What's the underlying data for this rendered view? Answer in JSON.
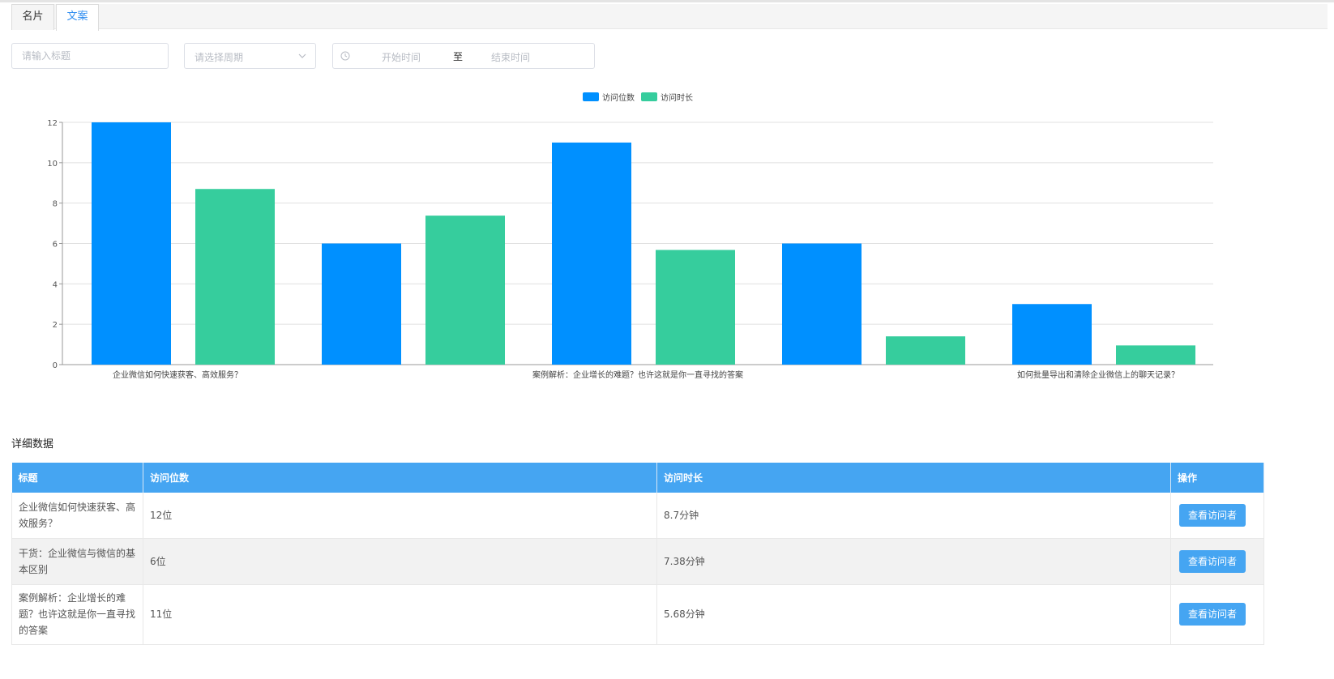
{
  "tabs": [
    {
      "label": "名片",
      "active": false
    },
    {
      "label": "文案",
      "active": true
    }
  ],
  "filters": {
    "title_placeholder": "请输入标题",
    "period_placeholder": "请选择周期",
    "start_placeholder": "开始时间",
    "range_separator": "至",
    "end_placeholder": "结束时间"
  },
  "colors": {
    "accent": "#2d8cf0",
    "series_visits": "#0090ff",
    "series_duration": "#36cd9d",
    "table_header": "#45a5f2"
  },
  "chart_data": {
    "type": "bar",
    "categories": [
      "企业微信如何快速获客、高效服务？",
      "干货：企业微信与微信的基本区别",
      "案例解析：企业增长的难题？也许这就是你一直寻找的答案",
      "",
      "如何批量导出和清除企业微信上的聊天记录？"
    ],
    "visible_tick_labels": [
      0,
      2,
      4
    ],
    "series": [
      {
        "name": "访问位数",
        "values": [
          12,
          6,
          11,
          6,
          3
        ]
      },
      {
        "name": "访问时长",
        "values": [
          8.7,
          7.38,
          5.68,
          1.4,
          0.95
        ]
      }
    ],
    "ylim": [
      0,
      12
    ],
    "yticks": [
      0,
      2,
      4,
      6,
      8,
      10,
      12
    ],
    "grid": true,
    "legend": "top-center"
  },
  "detail": {
    "title": "详细数据",
    "columns": [
      "标题",
      "访问位数",
      "访问时长",
      "操作"
    ],
    "rows": [
      {
        "title": "企业微信如何快速获客、高效服务？",
        "visits": "12位",
        "duration": "8.7分钟",
        "action": "查看访问者"
      },
      {
        "title": "干货：企业微信与微信的基本区别",
        "visits": "6位",
        "duration": "7.38分钟",
        "action": "查看访问者"
      },
      {
        "title": "案例解析：企业增长的难题？也许这就是你一直寻找的答案",
        "visits": "11位",
        "duration": "5.68分钟",
        "action": "查看访问者"
      }
    ]
  }
}
